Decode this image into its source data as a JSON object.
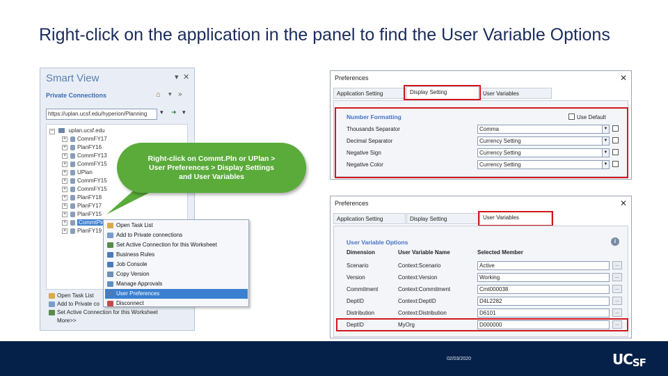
{
  "slide": {
    "title": "Right-click on the application in the panel to find the User Variable Options"
  },
  "smart_view": {
    "title": "Smart View",
    "pin_icon": "pin-icon",
    "close_icon": "close-icon",
    "connections_label": "Private Connections",
    "url_value": "https://uplan.ucsf.edu/hyperion/Planning",
    "tree_root": "uplan.ucsf.edu",
    "tree_items": [
      "CommFY17",
      "PlanFY16",
      "CommFY13",
      "CommFY15",
      "UPlan",
      "CommFY15",
      "CommFY15",
      "PlanFY18",
      "PlanFY17",
      "PlanFY15",
      "CommtPln",
      "PlanFY19"
    ],
    "bottom_links": [
      "Open Task List",
      "Add to Private co",
      "Set Active Connection for this Worksheet",
      "More>>"
    ]
  },
  "context_menu": {
    "items": [
      "Open Task List",
      "Add to Private connections",
      "Set Active Connection for this Worksheet",
      "Business Rules",
      "Job Console",
      "Copy Version",
      "Manage Approvals",
      "User Preferences",
      "Disconnect"
    ],
    "highlighted_index": 7
  },
  "callout": {
    "text": "Right-click on Commt.Pln or UPlan >\nUser Preferences > Display Settings\nand User Variables"
  },
  "dialog_display": {
    "title": "Preferences",
    "tabs": [
      "Application Setting",
      "Display Setting",
      "User Variables"
    ],
    "section_title": "Number Formatting",
    "use_default_label": "Use Default",
    "rows": [
      {
        "label": "Thousands Separator",
        "value": "Comma"
      },
      {
        "label": "Decimal Separator",
        "value": "Currency Setting"
      },
      {
        "label": "Negative Sign",
        "value": "Currency Setting"
      },
      {
        "label": "Negative Color",
        "value": "Currency Setting"
      }
    ]
  },
  "dialog_variables": {
    "title": "Preferences",
    "tabs": [
      "Application Setting",
      "Display Setting",
      "User Variables"
    ],
    "section_title": "User Variable Options",
    "info_icon": "info-icon",
    "headers": [
      "Dimension",
      "User Variable Name",
      "Selected Member"
    ],
    "rows": [
      {
        "dimension": "Scenario",
        "variable": "Context:Scenario",
        "member": "Active"
      },
      {
        "dimension": "Version",
        "variable": "Context:Version",
        "member": "Working"
      },
      {
        "dimension": "Commitment",
        "variable": "Context:Commitment",
        "member": "Cmt000038"
      },
      {
        "dimension": "DeptID",
        "variable": "Context:DeptID",
        "member": "D4L2282"
      },
      {
        "dimension": "Distribution",
        "variable": "Context:Distribution",
        "member": "D6101"
      },
      {
        "dimension": "DeptID",
        "variable": "MyOrg",
        "member": "D000000"
      }
    ]
  },
  "footer": {
    "date": "02/03/2020",
    "logo_main": "UC",
    "logo_sub": "SF"
  },
  "colors": {
    "title": "#1a2c5b",
    "highlight": "#d0181f",
    "callout": "#5aab3a",
    "footer": "#052049"
  }
}
